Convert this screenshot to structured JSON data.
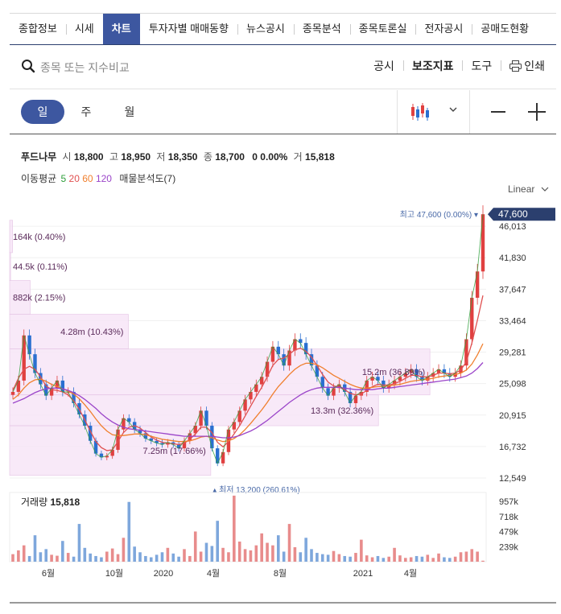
{
  "tabs": [
    "종합정보",
    "시세",
    "차트",
    "투자자별 매매동향",
    "뉴스공시",
    "종목분석",
    "종목토론실",
    "전자공시",
    "공매도현황"
  ],
  "active_tab": 2,
  "search": {
    "placeholder": "종목 또는 지수비교"
  },
  "tools": {
    "disclosure": "공시",
    "indicator": "보조지표",
    "tools": "도구",
    "print": "인쇄"
  },
  "periods": [
    "일",
    "주",
    "월"
  ],
  "active_period": 0,
  "quote": {
    "name": "푸드나무",
    "open_label": "시",
    "open": "18,800",
    "high_label": "고",
    "high": "18,950",
    "low_label": "저",
    "low": "18,350",
    "close_label": "종",
    "close": "18,700",
    "change": "0 0.00%",
    "volume_label": "거",
    "volume": "15,818"
  },
  "indicators": {
    "label": "이동평균",
    "ma5": "5",
    "ma20": "20",
    "ma60": "60",
    "ma120": "120",
    "volume_profile": "매물분석도(7)"
  },
  "scale_mode": "Linear",
  "colors": {
    "ma5": "#2e9e3a",
    "ma20": "#e05050",
    "ma60": "#f07f2e",
    "ma120": "#9b45c9",
    "up": "#e04040",
    "down": "#2a6fd0",
    "accent": "#3d57a0",
    "profile": "#f7e6f7"
  },
  "chart_data": {
    "type": "candlestick",
    "price_axis": {
      "ylim": [
        11700,
        48800
      ],
      "ticks": [
        "46,013",
        "41,830",
        "37,647",
        "33,464",
        "29,281",
        "25,098",
        "20,915",
        "16,732",
        "12,549"
      ]
    },
    "current_price_label": "47,600",
    "max_marker": "최고 47,600 (0.00%)",
    "min_marker": "최저 13,200 (260.61%)",
    "x_labels": [
      "6월",
      "10월",
      "2020",
      "4월",
      "8월",
      "2021",
      "4월"
    ],
    "volume_profile": [
      {
        "label": "164k (0.40%)",
        "price_from": 42500,
        "price_to": 46800,
        "fraction": 0.006
      },
      {
        "label": "44.5k (0.11%)",
        "price_from": 38800,
        "price_to": 42500,
        "fraction": 0.002
      },
      {
        "label": "882k (2.15%)",
        "price_from": 34300,
        "price_to": 38800,
        "fraction": 0.043
      },
      {
        "label": "4.28m (10.43%)",
        "price_from": 29700,
        "price_to": 34300,
        "fraction": 0.249
      },
      {
        "label": "15.2m (36.89%)",
        "price_from": 23600,
        "price_to": 29700,
        "fraction": 0.882
      },
      {
        "label": "13.3m (32.36%)",
        "price_from": 19500,
        "price_to": 23600,
        "fraction": 0.774
      },
      {
        "label": "7.25m (17.66%)",
        "price_from": 12900,
        "price_to": 19500,
        "fraction": 0.422
      }
    ],
    "price_series": {
      "name": "close",
      "values": [
        24000,
        25500,
        31500,
        29000,
        26500,
        25000,
        23500,
        24500,
        25500,
        24000,
        24000,
        22500,
        21000,
        19500,
        17500,
        15800,
        15300,
        15500,
        16300,
        19000,
        20500,
        20000,
        19000,
        18500,
        17800,
        17500,
        17200,
        17000,
        17300,
        17000,
        16500,
        17500,
        18500,
        19500,
        21500,
        19500,
        16500,
        14500,
        16000,
        19000,
        20000,
        21500,
        23000,
        24000,
        25000,
        26000,
        28000,
        30000,
        29000,
        27500,
        29500,
        31000,
        30500,
        29000,
        27500,
        26000,
        24500,
        23500,
        24500,
        25000,
        24000,
        22500,
        23500,
        24000,
        25500,
        26000,
        25500,
        24500,
        25000,
        25500,
        26000,
        26500,
        27000,
        26000,
        25500,
        26000,
        26500,
        27000,
        26500,
        26000,
        26500,
        27500,
        31000,
        36500,
        40000,
        47600
      ]
    },
    "ma_series": [
      {
        "name": "20",
        "values": [
          24200,
          25800,
          27000,
          27400,
          27000,
          26000,
          24800,
          24300,
          24200,
          24000,
          23600,
          22800,
          21700,
          20300,
          18800,
          17400,
          16600,
          16200,
          16300,
          17400,
          18600,
          19300,
          19500,
          19200,
          18600,
          18000,
          17600,
          17300,
          17200,
          17100,
          17000,
          17200,
          17700,
          18400,
          19300,
          19300,
          18600,
          17300,
          16700,
          17400,
          18400,
          19500,
          20800,
          22100,
          23400,
          24600,
          26000,
          27500,
          28300,
          28500,
          29000,
          29600,
          29800,
          29400,
          28600,
          27500,
          26300,
          25300,
          24800,
          24600,
          24300,
          23800,
          23600,
          23700,
          24200,
          24700,
          25000,
          24900,
          24900,
          25100,
          25400,
          25800,
          26200,
          26200,
          26000,
          26000,
          26200,
          26500,
          26500,
          26400,
          26500,
          26900,
          28000,
          30500,
          33500,
          36800
        ]
      },
      {
        "name": "60",
        "values": [
          23000,
          23600,
          24500,
          25200,
          25600,
          25700,
          25400,
          25000,
          24700,
          24400,
          24100,
          23700,
          23100,
          22300,
          21400,
          20400,
          19500,
          18800,
          18300,
          18200,
          18200,
          18300,
          18400,
          18400,
          18300,
          18100,
          17900,
          17700,
          17600,
          17500,
          17400,
          17400,
          17500,
          17700,
          18000,
          18100,
          17900,
          17600,
          17400,
          17500,
          17800,
          18300,
          19000,
          19800,
          20700,
          21600,
          22600,
          23700,
          24700,
          25500,
          26300,
          27000,
          27500,
          27800,
          27800,
          27600,
          27200,
          26700,
          26200,
          25800,
          25400,
          25000,
          24700,
          24500,
          24500,
          24600,
          24700,
          24700,
          24800,
          24900,
          25000,
          25200,
          25400,
          25500,
          25600,
          25700,
          25800,
          26000,
          26100,
          26200,
          26300,
          26500,
          26900,
          27700,
          28900,
          30400
        ]
      },
      {
        "name": "120",
        "values": [
          22500,
          22800,
          23100,
          23500,
          23900,
          24200,
          24400,
          24500,
          24500,
          24400,
          24200,
          23900,
          23500,
          23000,
          22400,
          21800,
          21100,
          20500,
          20000,
          19600,
          19300,
          19100,
          19000,
          18900,
          18800,
          18700,
          18600,
          18500,
          18400,
          18300,
          18200,
          18100,
          18100,
          18100,
          18100,
          18100,
          18100,
          18000,
          17900,
          17900,
          18000,
          18200,
          18500,
          18800,
          19200,
          19700,
          20200,
          20800,
          21400,
          22000,
          22600,
          23100,
          23600,
          24000,
          24300,
          24500,
          24600,
          24600,
          24600,
          24600,
          24500,
          24400,
          24300,
          24300,
          24300,
          24300,
          24400,
          24500,
          24500,
          24600,
          24700,
          24800,
          24900,
          25000,
          25100,
          25200,
          25300,
          25400,
          25500,
          25600,
          25700,
          25900,
          26100,
          26500,
          27100,
          27900
        ]
      }
    ],
    "volume": {
      "label": "거래량",
      "value": "15,818",
      "ylim": [
        0,
        1100000
      ],
      "ticks": [
        "957k",
        "718k",
        "479k",
        "239k"
      ],
      "values": [
        120000,
        180000,
        260000,
        90000,
        420000,
        150000,
        200000,
        110000,
        95000,
        330000,
        140000,
        80000,
        600000,
        220000,
        130000,
        90000,
        70000,
        160000,
        210000,
        120000,
        380000,
        950000,
        240000,
        150000,
        90000,
        70000,
        110000,
        150000,
        220000,
        130000,
        80000,
        200000,
        90000,
        480000,
        160000,
        300000,
        250000,
        650000,
        220000,
        150000,
        1050000,
        320000,
        200000,
        180000,
        260000,
        450000,
        300000,
        260000,
        420000,
        160000,
        600000,
        230000,
        150000,
        380000,
        200000,
        140000,
        120000,
        110000,
        170000,
        120000,
        90000,
        80000,
        140000,
        350000,
        100000,
        70000,
        90000,
        60000,
        80000,
        220000,
        100000,
        60000,
        70000,
        90000,
        80000,
        110000,
        60000,
        130000,
        70000,
        60000,
        80000,
        150000,
        160000,
        200000,
        160000,
        15818
      ]
    }
  }
}
